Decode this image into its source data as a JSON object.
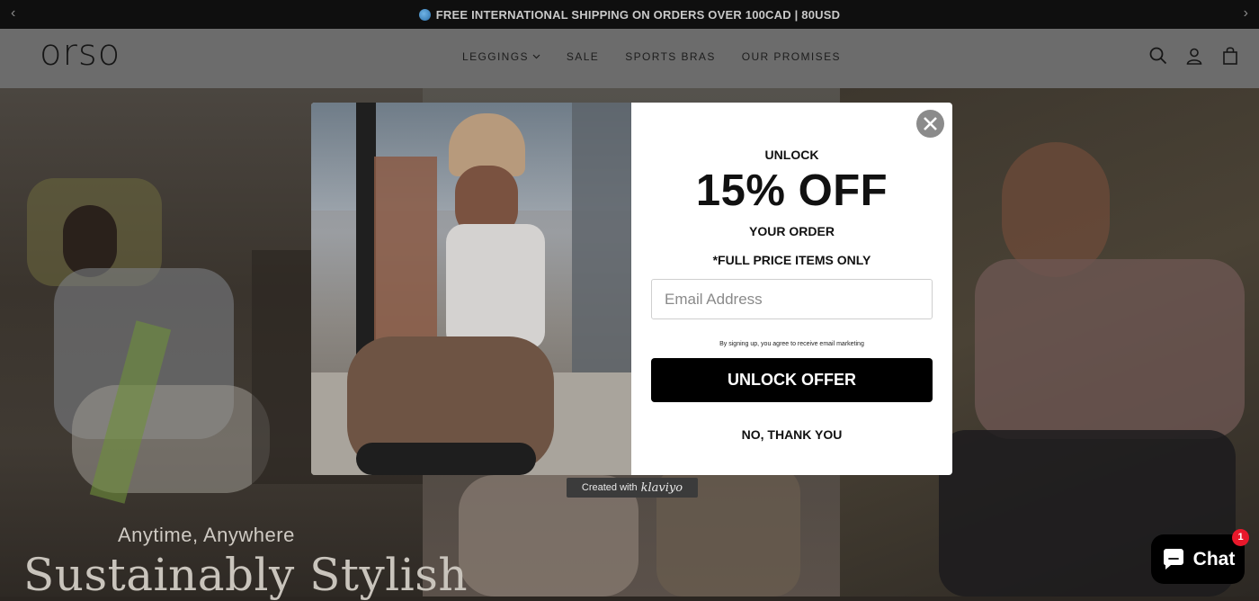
{
  "announcement": {
    "text": "FREE INTERNATIONAL SHIPPING ON ORDERS OVER 100CAD | 80USD",
    "prev_icon": "chevron-left-icon",
    "next_icon": "chevron-right-icon"
  },
  "header": {
    "logo": "orso",
    "nav": [
      {
        "label": "LEGGINGS",
        "has_dropdown": true
      },
      {
        "label": "SALE"
      },
      {
        "label": "SPORTS BRAS"
      },
      {
        "label": "OUR PROMISES"
      }
    ],
    "icons": [
      "search-icon",
      "account-icon",
      "cart-icon"
    ]
  },
  "hero": {
    "subtitle": "Anytime, Anywhere",
    "title": "Sustainably Stylish"
  },
  "popup": {
    "heading_small": "UNLOCK",
    "heading_big": "15% OFF",
    "heading_sub": "YOUR ORDER",
    "note": "*FULL PRICE ITEMS ONLY",
    "email_placeholder": "Email Address",
    "consent": "By signing up, you agree to receive email marketing",
    "cta": "UNLOCK OFFER",
    "decline": "NO, THANK YOU",
    "close_icon": "close-icon"
  },
  "klaviyo_badge": {
    "prefix": "Created with",
    "brand": "klaviyo"
  },
  "chat": {
    "label": "Chat",
    "badge_count": "1"
  },
  "colors": {
    "announcement_bg": "#0f0f0f",
    "header_bg": "#6c6c6c",
    "cta_bg": "#000000",
    "badge": "#e8182b"
  }
}
